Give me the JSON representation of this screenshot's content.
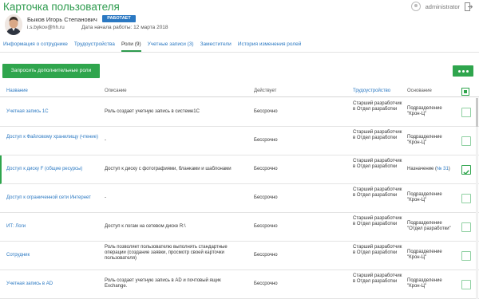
{
  "header": {
    "title": "Карточка пользователя",
    "admin_name": "administrator"
  },
  "user": {
    "name": "Быков Игорь Степанович",
    "status": "РАБОТАЕТ",
    "email": "i.s.bykov@hh.ru",
    "start_date": "Дата начала работы: 12 марта 2018"
  },
  "tabs": [
    {
      "label": "Информация о сотруднике"
    },
    {
      "label": "Трудоустройства"
    },
    {
      "label": "Роли (9)",
      "active": true
    },
    {
      "label": "Учетные записи (3)"
    },
    {
      "label": "Заместители"
    },
    {
      "label": "История изменения ролей"
    }
  ],
  "actions": {
    "request_roles_label": "Запросить дополнительные роли"
  },
  "table": {
    "columns": [
      "Название",
      "Описание",
      "Действует",
      "Трудоустройство",
      "Основание"
    ],
    "rows": [
      {
        "name": "Учетная запись 1С",
        "description": "Роль создает учетную запись в системе1С",
        "valid": "Бессрочно",
        "position": "Старший разработчик в Отдел разработки",
        "basis": "Подразделение \"Крон-Ц\"",
        "checked": false
      },
      {
        "name": "Доступ к Файловому хранилищу (чтение)",
        "description": "-",
        "valid": "Бессрочно",
        "position": "Старший разработчик в Отдел разработки",
        "basis": "Подразделение \"Крон-Ц\"",
        "checked": false
      },
      {
        "name": "Доступ к диску F (общие ресурсы)",
        "description": "Доступ к диску с фотографиями, бланками и шаблонами",
        "valid": "Бессрочно",
        "position": "Старший разработчик в Отдел разработки",
        "basis": "Назначение (",
        "basis_link": "№ 31",
        "basis_suffix": ")",
        "checked": true
      },
      {
        "name": "Доступ к ограниченной сети Интернет",
        "description": "-",
        "valid": "Бессрочно",
        "position": "Старший разработчик в Отдел разработки",
        "basis": "Подразделение \"Крон-Ц\"",
        "checked": false
      },
      {
        "name": "ИТ: Логи",
        "description": "Доступ к логам на сетевом диске R:\\",
        "valid": "Бессрочно",
        "position": "Старший разработчик в Отдел разработки",
        "basis": "Подразделение \"Отдел разработки\"",
        "checked": false
      },
      {
        "name": "Сотрудник",
        "description": "Роль позволяет пользователю выполнять стандартные операции (создание заявки, просмотр своей карточки пользователя)",
        "valid": "Бессрочно",
        "position": "Старший разработчик в Отдел разработки",
        "basis": "Подразделение \"Крон-Ц\"",
        "checked": false
      },
      {
        "name": "Учетная запись в AD",
        "description": "Роль создает учетную запись в AD и почтовый ящик Exchange.",
        "valid": "Бессрочно",
        "position": "Старший разработчик в Отдел разработки",
        "basis": "Подразделение \"Крон-Ц\"",
        "checked": false
      }
    ]
  },
  "colors": {
    "accent_green": "#2fa54d",
    "link_blue": "#2a78c2",
    "status_blue": "#2a78c2"
  },
  "icons": [
    "user-avatar-icon",
    "logout-icon",
    "more-dots-icon",
    "checkbox-icon",
    "check-mark-icon"
  ]
}
